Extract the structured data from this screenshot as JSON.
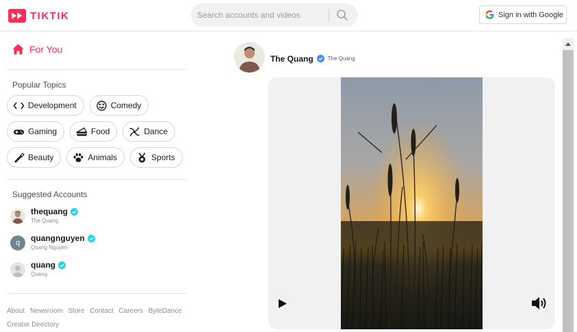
{
  "brand": {
    "name": "TIKTIK",
    "accent": "#fe2c55"
  },
  "search": {
    "placeholder": "Search accounts and videos",
    "value": ""
  },
  "auth": {
    "signin_label": "Sign in with Google"
  },
  "sidebar": {
    "for_you_label": "For You",
    "topics_title": "Popular Topics",
    "topics": [
      {
        "label": "Development",
        "icon": "code-icon"
      },
      {
        "label": "Comedy",
        "icon": "smile-icon"
      },
      {
        "label": "Gaming",
        "icon": "gamepad-icon"
      },
      {
        "label": "Food",
        "icon": "cake-icon"
      },
      {
        "label": "Dance",
        "icon": "dance-icon"
      },
      {
        "label": "Beauty",
        "icon": "lipstick-icon"
      },
      {
        "label": "Animals",
        "icon": "paw-icon"
      },
      {
        "label": "Sports",
        "icon": "medal-icon"
      }
    ],
    "suggested_title": "Suggested Accounts",
    "accounts": [
      {
        "username": "thequang",
        "name": "The Quang"
      },
      {
        "username": "quangnguyen",
        "name": "Quang Nguyen",
        "initial": "q"
      },
      {
        "username": "quang",
        "name": "Quang"
      }
    ],
    "footer_links": [
      "About",
      "Newsroom",
      "Store",
      "Contact",
      "Careers",
      "ByteDance",
      "Creator Directory"
    ]
  },
  "post": {
    "display_name": "The Quang",
    "handle": "The Quang"
  }
}
